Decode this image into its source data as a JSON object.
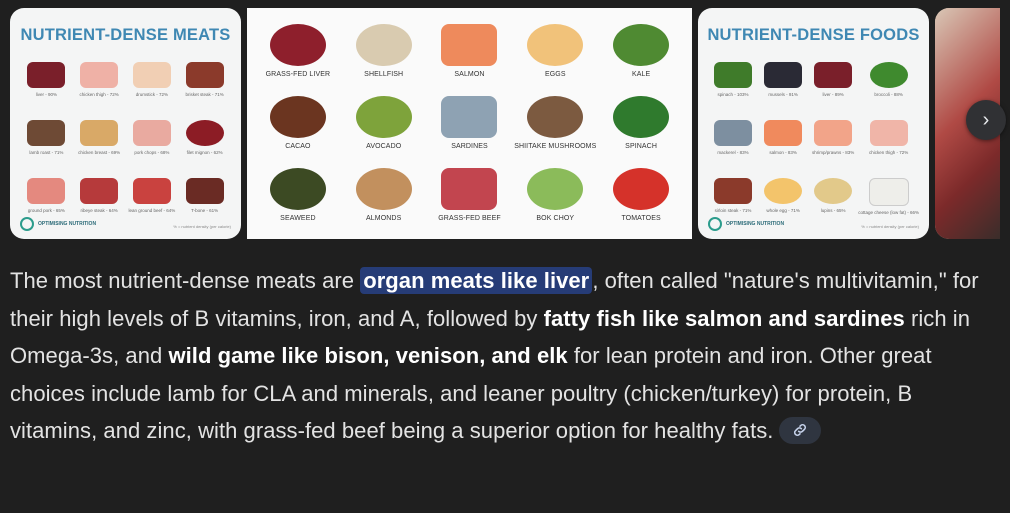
{
  "images": {
    "card1": {
      "title": "NUTRIENT-DENSE MEATS",
      "items": [
        "liver - 90%",
        "chicken thigh - 72%",
        "drumstick - 72%",
        "brisket steak - 71%",
        "lamb roast - 71%",
        "chicken breast - 69%",
        "pork chops - 68%",
        "filet mignon - 62%",
        "ground pork - 65%",
        "ribeye steak - 64%",
        "lean ground beef - 64%",
        "T-bone - 61%"
      ],
      "brand": "OPTIMISING NUTRITION",
      "footnote": "% = nutrient density (per calorie)"
    },
    "card2": {
      "items": [
        "GRASS-FED LIVER",
        "SHELLFISH",
        "SALMON",
        "EGGS",
        "KALE",
        "CACAO",
        "AVOCADO",
        "SARDINES",
        "SHIITAKE MUSHROOMS",
        "SPINACH",
        "SEAWEED",
        "ALMONDS",
        "GRASS-FED BEEF",
        "BOK CHOY",
        "TOMATOES"
      ]
    },
    "card3": {
      "title": "NUTRIENT-DENSE FOODS",
      "items": [
        "spinach - 103%",
        "mussels - 91%",
        "liver - 89%",
        "broccoli - 88%",
        "mackerel - 83%",
        "salmon - 83%",
        "shrimp/prawns - 83%",
        "chicken thigh - 72%",
        "sirloin steak - 71%",
        "whole egg - 71%",
        "lupins - 65%",
        "cottage cheese (low fat) - 66%"
      ],
      "brand": "OPTIMISING NUTRITION",
      "footnote": "% = nutrient density (per calorie)"
    },
    "next_icon": "chevron-right-icon"
  },
  "answer": {
    "p1": "The most nutrient-dense meats are ",
    "h1": "organ meats like liver",
    "p2": ", often called \"nature's multivitamin,\" for their high levels of B vitamins, iron, and A, followed by ",
    "b1": "fatty fish like salmon and sardines",
    "p3": " rich in Omega-3s, and ",
    "b2": "wild game like bison, venison, and elk",
    "p4": " for lean protein and iron. Other great choices include lamb for CLA and minerals, and leaner poultry (chicken/turkey) for protein, B vitamins, and zinc, with grass-fed beef being a superior option for healthy fats.",
    "link_icon": "link-icon"
  }
}
